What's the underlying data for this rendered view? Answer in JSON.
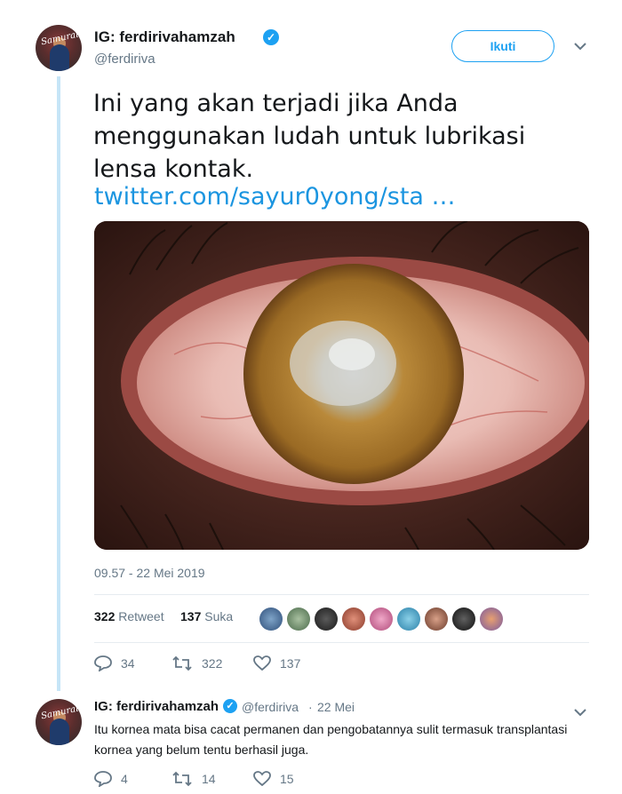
{
  "tweet": {
    "author_name": "IG: ferdirivahamzah",
    "author_handle": "@ferdiriva",
    "follow_label": "Ikuti",
    "text": "Ini yang akan terjadi jika Anda menggunakan ludah untuk lubrikasi lensa kontak.",
    "link_text": "twitter.com/sayur0yong/sta …",
    "timestamp": "09.57 - 22 Mei 2019",
    "retweet_count": "322",
    "retweet_label": "Retweet",
    "like_count": "137",
    "like_label": "Suka",
    "likers_count": 9,
    "actions": {
      "reply": "34",
      "retweet": "322",
      "like": "137"
    }
  },
  "reply": {
    "author_name": "IG: ferdirivahamzah",
    "author_handle": "@ferdiriva",
    "separator": "·",
    "date": "22 Mei",
    "text": "Itu kornea mata bisa cacat permanen dan pengobatannya sulit termasuk transplantasi kornea yang belum tentu berhasil juga.",
    "actions": {
      "reply": "4",
      "retweet": "14",
      "like": "15"
    }
  },
  "avatar_text": "Samurai",
  "icons": {
    "verified": "verified-badge-icon",
    "caret": "chevron-down-icon",
    "reply": "reply-icon",
    "retweet": "retweet-icon",
    "like": "heart-icon"
  },
  "colors": {
    "accent": "#1da1f2",
    "link": "#1b95e0",
    "secondary_text": "#657786",
    "thread_line": "#c6e5f7"
  }
}
